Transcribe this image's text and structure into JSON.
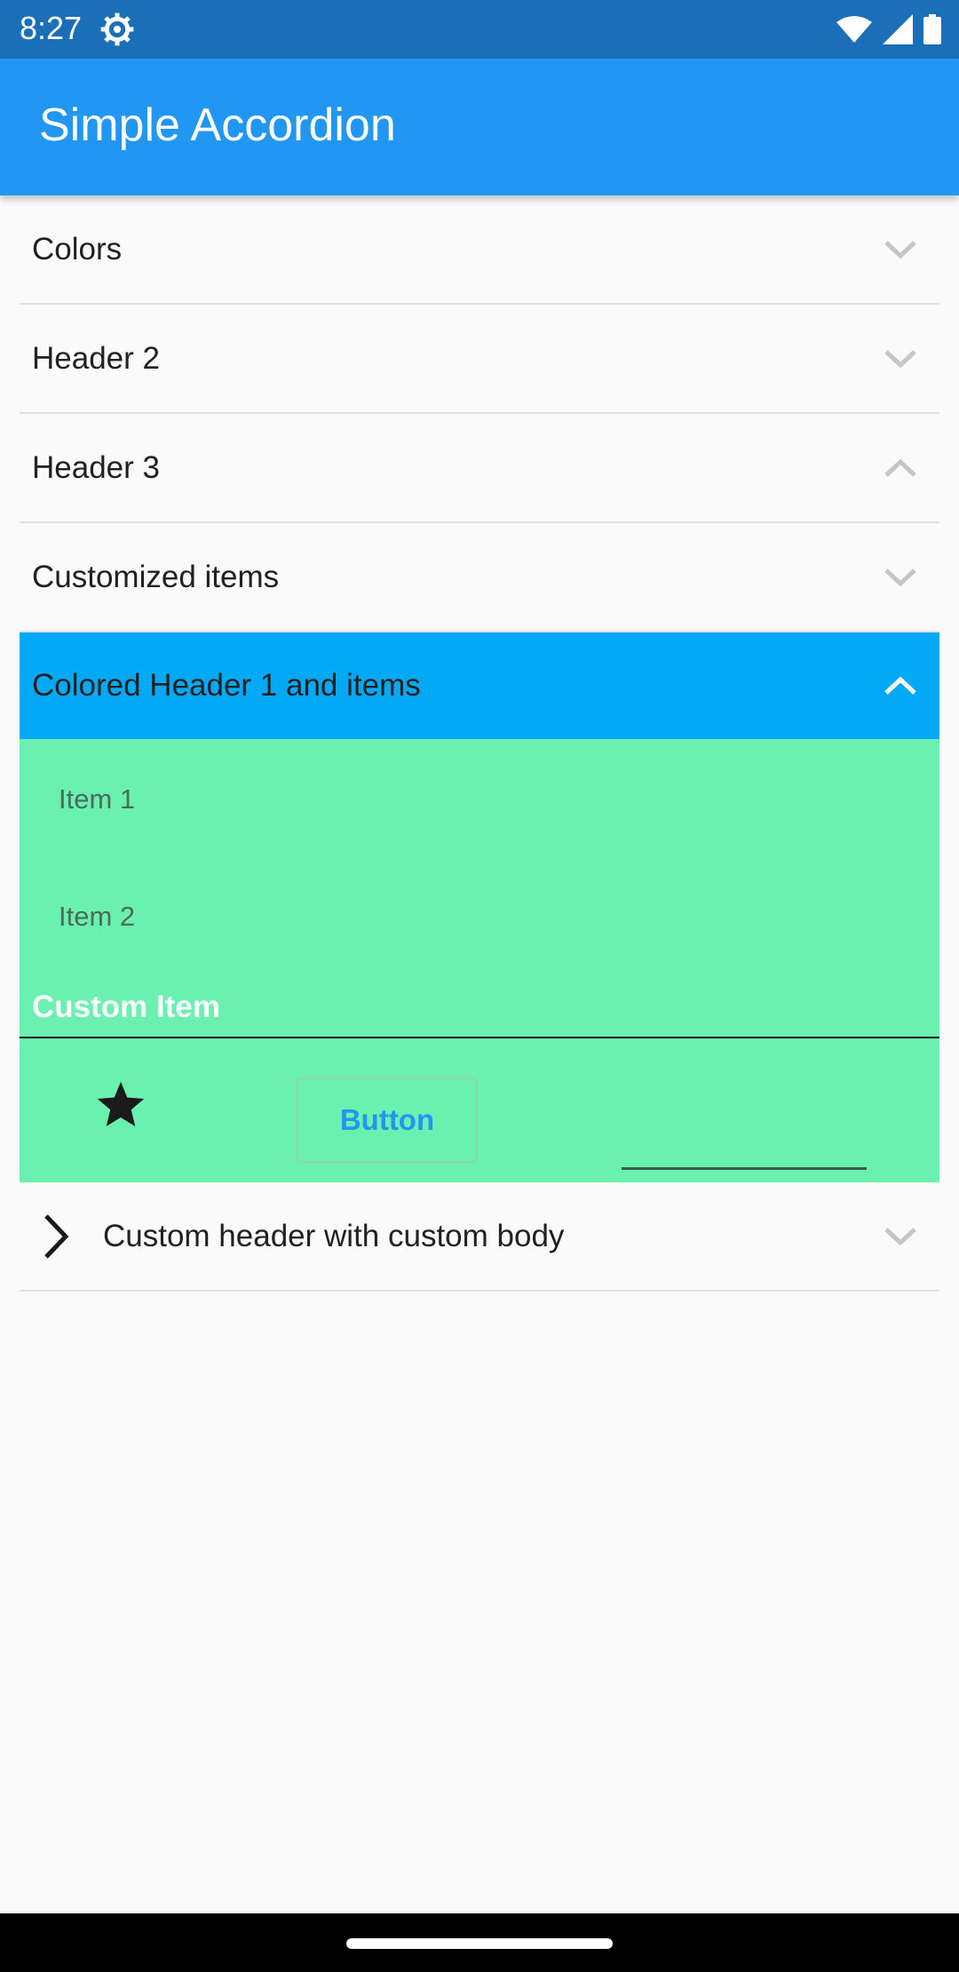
{
  "status_bar": {
    "time": "8:27"
  },
  "app_bar": {
    "title": "Simple Accordion"
  },
  "accordion": {
    "headers": [
      {
        "label": "Colors"
      },
      {
        "label": "Header 2"
      },
      {
        "label": "Header 3"
      },
      {
        "label": "Customized items"
      }
    ],
    "colored_section": {
      "label": "Colored Header 1 and items",
      "items": [
        "Item 1",
        "Item 2"
      ],
      "custom_item_title": "Custom Item",
      "button_label": "Button"
    },
    "custom_header": {
      "label": "Custom header with custom body"
    }
  },
  "colors": {
    "status_bar": "#1b6fb8",
    "app_bar": "#2196f3",
    "colored_header": "#03a9f4",
    "section_body": "#6af1af",
    "button_text": "#2196f3"
  }
}
